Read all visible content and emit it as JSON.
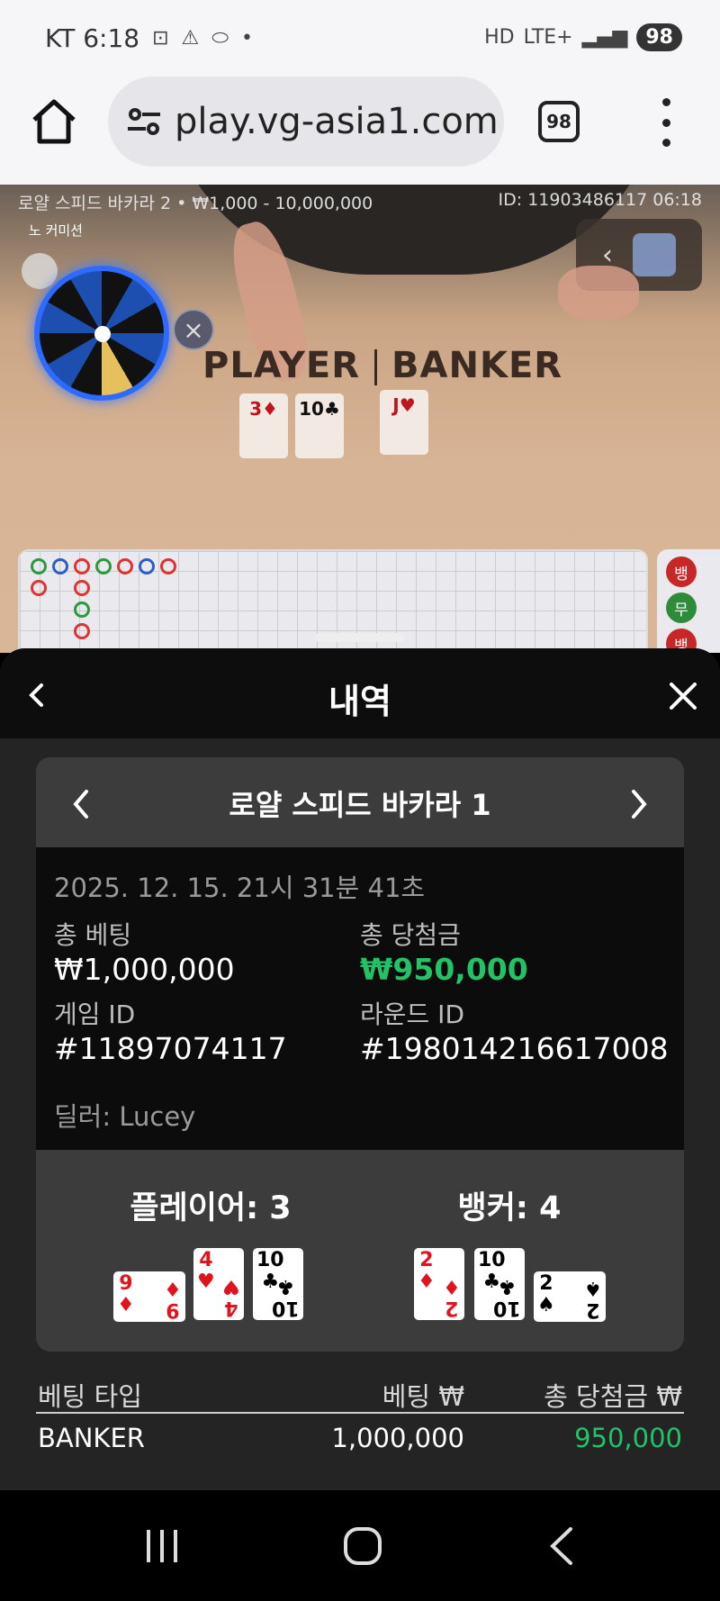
{
  "status_bar": {
    "carrier_time": "KT 6:18",
    "network": "LTE+",
    "battery": "98"
  },
  "browser": {
    "url": "play.vg-asia1.com",
    "tab_count": "98"
  },
  "game": {
    "info": "로얄 스피드 바카라 2 • ₩1,000 - 10,000,000",
    "id_time": "ID: 11903486117 06:18",
    "no_commission": "노 커미션",
    "player_label": "PLAYER",
    "banker_label": "BANKER",
    "table_cards": [
      {
        "rank": "3",
        "suit": "♦",
        "color": "red"
      },
      {
        "rank": "10",
        "suit": "♣",
        "color": "black"
      },
      {
        "rank": "J",
        "suit": "♥",
        "color": "red"
      }
    ],
    "side_road": [
      "뱅",
      "무",
      "뱅"
    ]
  },
  "history": {
    "title": "내역",
    "game_name": "로얄 스피드 바카라 1",
    "timestamp": "2025. 12. 15. 21시 31분 41초",
    "total_bet_label": "총 베팅",
    "total_bet": "₩1,000,000",
    "total_win_label": "총 당첨금",
    "total_win": "₩950,000",
    "game_id_label": "게임 ID",
    "game_id": "#11897074117",
    "round_id_label": "라운드 ID",
    "round_id": "#198014216617008",
    "dealer": "딜러: Lucey",
    "player_result": "플레이어: 3",
    "banker_result": "뱅커: 4",
    "player_cards": [
      {
        "rank": "9",
        "suit": "♦",
        "color": "red",
        "rotated": true
      },
      {
        "rank": "4",
        "suit": "♥",
        "color": "red",
        "rotated": false
      },
      {
        "rank": "10",
        "suit": "♣",
        "color": "black",
        "rotated": false
      }
    ],
    "banker_cards": [
      {
        "rank": "2",
        "suit": "♦",
        "color": "red",
        "rotated": false
      },
      {
        "rank": "10",
        "suit": "♣",
        "color": "black",
        "rotated": false
      },
      {
        "rank": "2",
        "suit": "♠",
        "color": "black",
        "rotated": true
      }
    ],
    "table": {
      "headers": [
        "베팅 타입",
        "베팅 ₩",
        "총 당첨금 ₩"
      ],
      "rows": [
        [
          "BANKER",
          "1,000,000",
          "950,000"
        ]
      ]
    }
  },
  "colors": {
    "win_green": "#23c267",
    "card_red": "#e0141e",
    "sheet_bg": "#242424"
  }
}
